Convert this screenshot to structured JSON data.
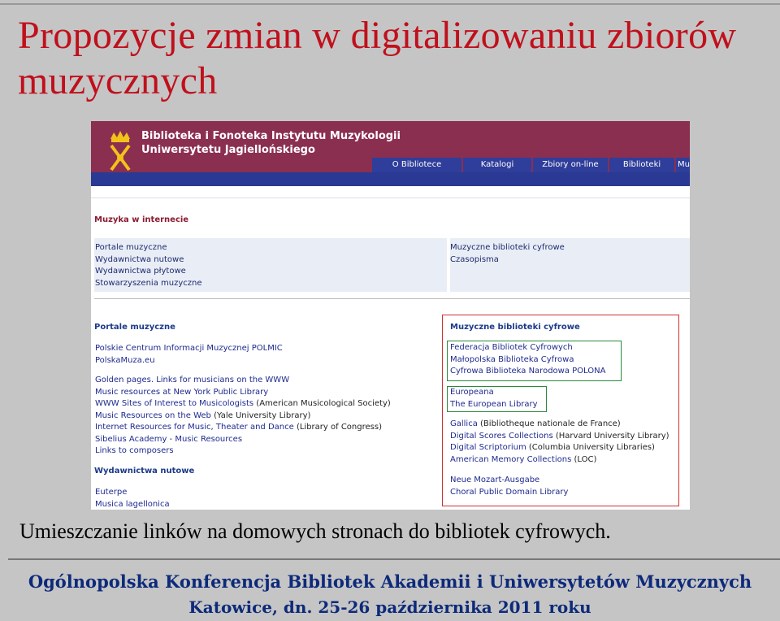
{
  "slide": {
    "title": "Propozycje  zmian  w  digitalizowaniu zbiorów muzycznych",
    "caption": "Umieszczanie linków na domowych stronach do bibliotek cyfrowych.",
    "footer_line1": "Ogólnopolska Konferencja Bibliotek Akademii i Uniwersytetów Muzycznych",
    "footer_line2": "Katowice, dn. 25-26 października 2011 roku"
  },
  "site": {
    "name_line1": "Biblioteka i Fonoteka Instytutu Muzykologii",
    "name_line2": "Uniwersytetu Jagiellońskiego",
    "nav": [
      "O Bibliotece",
      "Katalogi",
      "Zbiory on-line",
      "Biblioteki",
      "Muz"
    ],
    "section_title": "Muzyka w internecie",
    "top_left_links": [
      "Portale muzyczne",
      "Wydawnictwa nutowe",
      "Wydawnictwa płytowe",
      "Stowarzyszenia muzyczne"
    ],
    "top_right_links": [
      "Muzyczne biblioteki cyfrowe",
      "Czasopisma"
    ],
    "portale": {
      "title": "Portale muzyczne",
      "group1": [
        "Polskie Centrum Informacji Muzycznej POLMIC",
        "PolskaMuza.eu"
      ],
      "group2": [
        {
          "link": "Golden pages. Links for musicians on the WWW",
          "note": ""
        },
        {
          "link": "Music resources at New York Public Library",
          "note": ""
        },
        {
          "link": "WWW Sites of Interest to Musicologists",
          "note": " (American Musicological Society)"
        },
        {
          "link": "Music Resources on the Web",
          "note": " (Yale University Library)"
        },
        {
          "link": "Internet Resources for Music, Theater and Dance",
          "note": " (Library of Congress)"
        },
        {
          "link": "Sibelius Academy - Music Resources",
          "note": ""
        },
        {
          "link": "Links to composers",
          "note": ""
        }
      ]
    },
    "wydawnictwa": {
      "title": "Wydawnictwa nutowe",
      "items": [
        "Euterpe",
        "Musica lagellonica"
      ]
    },
    "biblioteki": {
      "title": "Muzyczne biblioteki cyfrowe",
      "polish": [
        "Federacja Bibliotek Cyfrowych",
        "Małopolska Biblioteka Cyfrowa",
        "Cyfrowa Biblioteka Narodowa POLONA"
      ],
      "european": [
        "Europeana",
        "The European Library"
      ],
      "other": [
        {
          "link": "Gallica",
          "note": " (Bibliotheque nationale de France)"
        },
        {
          "link": "Digital Scores Collections",
          "note": " (Harvard University Library)"
        },
        {
          "link": "Digital Scriptorium",
          "note": " (Columbia University Libraries)"
        },
        {
          "link": "American Memory Collections",
          "note": " (LOC)"
        }
      ],
      "more": [
        "Neue Mozart-Ausgabe",
        "Choral Public Domain Library"
      ]
    }
  },
  "colors": {
    "title_red": "#c0101c",
    "header_maroon": "#8b2f50",
    "nav_blue": "#2f3e9a",
    "footer_blue": "#0d2a7a",
    "box_red": "#d03030",
    "box_green": "#2a8a3a"
  }
}
